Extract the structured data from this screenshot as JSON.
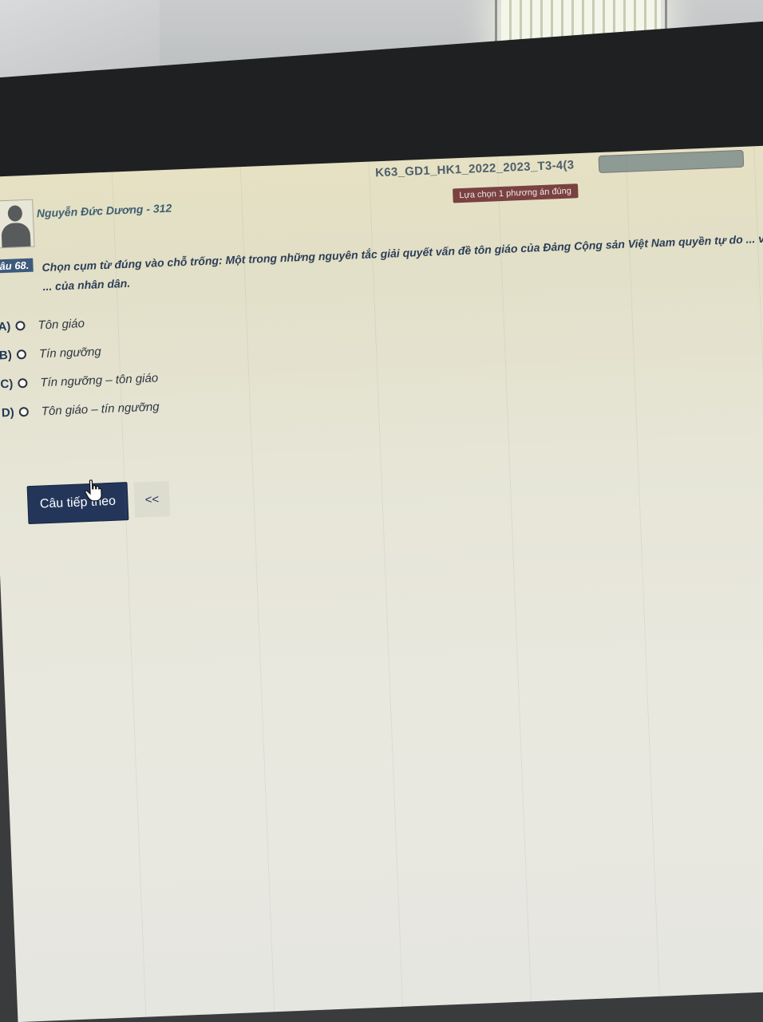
{
  "header": {
    "user_name": "Nguyễn Đức Dương - 312",
    "exam_title": "K63_GD1_HK1_2022_2023_T3-4(3",
    "hint": "Lựa chọn 1 phương án đúng"
  },
  "question": {
    "number_label": "âu 68.",
    "text": "Chọn cụm từ đúng vào chỗ trống: Một trong những nguyên tắc giải quyết vấn đề tôn giáo của Đảng Cộng sản Việt Nam quyền tự do ... và không ... của nhân dân.",
    "options": [
      {
        "letter": "A)",
        "text": "Tôn giáo"
      },
      {
        "letter": "B)",
        "text": "Tín ngưỡng"
      },
      {
        "letter": "C)",
        "text": "Tín ngưỡng – tôn giáo"
      },
      {
        "letter": "D)",
        "text": "Tôn giáo – tín ngưỡng"
      }
    ]
  },
  "navigation": {
    "next_label": "Câu tiếp theo",
    "prev_label": "<<"
  },
  "colors": {
    "button_bg": "#23365a",
    "hint_bg": "#7a4141",
    "question_number_bg": "#3d5a7b"
  }
}
